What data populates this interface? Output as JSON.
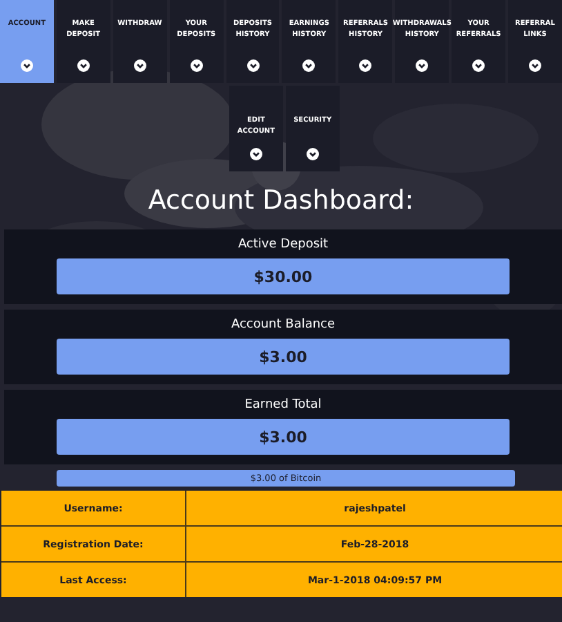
{
  "nav": [
    {
      "label": "ACCOUNT",
      "selected": true
    },
    {
      "label": "MAKE DEPOSIT",
      "selected": false
    },
    {
      "label": "WITHDRAW",
      "selected": false
    },
    {
      "label": "YOUR DEPOSITS",
      "selected": false
    },
    {
      "label": "DEPOSITS HISTORY",
      "selected": false
    },
    {
      "label": "EARNINGS HISTORY",
      "selected": false
    },
    {
      "label": "REFERRALS HISTORY",
      "selected": false
    },
    {
      "label": "WITHDRAWALS HISTORY",
      "selected": false
    },
    {
      "label": "YOUR REFERRALS",
      "selected": false
    },
    {
      "label": "REFERRAL LINKS",
      "selected": false
    }
  ],
  "nav_row_2": [
    {
      "label": "EDIT ACCOUNT",
      "selected": false
    },
    {
      "label": "SECURITY",
      "selected": false
    }
  ],
  "title": "Account Dashboard:",
  "stats": [
    {
      "label": "Active Deposit",
      "value": "$30.00"
    },
    {
      "label": "Account Balance",
      "value": "$3.00"
    },
    {
      "label": "Earned Total",
      "value": "$3.00"
    }
  ],
  "currency_note": "$3.00 of Bitcoin",
  "details": [
    {
      "label": "Username:",
      "value": "rajeshpatel"
    },
    {
      "label": "Registration Date:",
      "value": "Feb-28-2018"
    },
    {
      "label": "Last Access:",
      "value": "Mar-1-2018 04:09:57 PM"
    }
  ]
}
